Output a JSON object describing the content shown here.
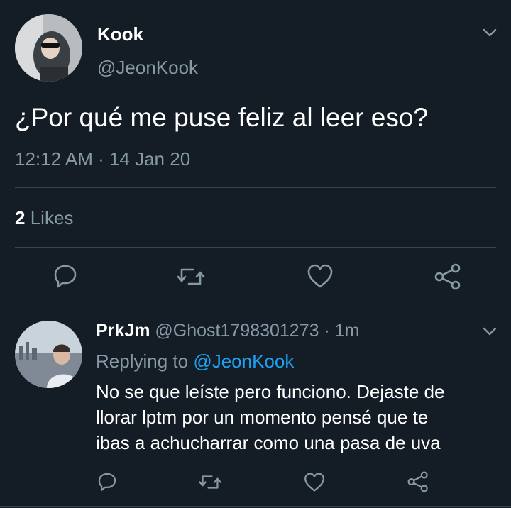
{
  "main_tweet": {
    "author_name": "Kook",
    "author_handle": "@JeonKook",
    "text": "¿Por qué me puse feliz al leer eso?",
    "timestamp": "12:12 AM · 14 Jan 20",
    "likes_count": "2",
    "likes_label": "Likes"
  },
  "reply": {
    "author_name": "PrkJm",
    "author_handle": "@Ghost1798301273",
    "time_ago": "· 1m",
    "replying_to_label": "Replying to",
    "replying_to_handle": "@JeonKook",
    "text_lines": [
      "No se que leíste pero funciono. Dejaste de",
      "llorar lptm por un momento pensé que te",
      "ibas a achucharrar como una pasa de uva"
    ]
  },
  "icons": [
    "chevron-down-icon",
    "reply-icon",
    "retweet-icon",
    "like-icon",
    "share-icon"
  ],
  "colors": {
    "background": "#141d26",
    "muted_text": "#8899a6",
    "divider": "#38444d",
    "link": "#1da1f2",
    "text": "#ffffff"
  }
}
